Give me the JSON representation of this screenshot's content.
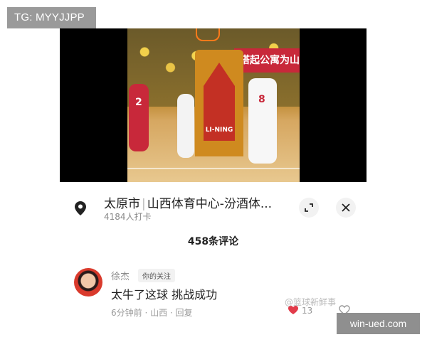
{
  "watermarks": {
    "tg": "TG: MYYJJPP",
    "weibo": "@篮球新鲜事",
    "site": "win-ued.com"
  },
  "video": {
    "banner_text": "搭起公寓为山",
    "brand": "LI-NING",
    "jersey_red": "2",
    "jersey_white": "8"
  },
  "location": {
    "city": "太原市",
    "venue": "山西体育中心-汾酒体...",
    "checkins": "4184人打卡",
    "pin_icon": "map-pin-icon",
    "expand_icon": "expand-icon",
    "close_icon": "close-icon"
  },
  "comments": {
    "count_label": "458条评论",
    "items": [
      {
        "name": "徐杰",
        "tag": "你的关注",
        "text": "太牛了这球 挑战成功",
        "meta": "6分钟前 · 山西 · 回复",
        "likes": "13"
      }
    ]
  }
}
